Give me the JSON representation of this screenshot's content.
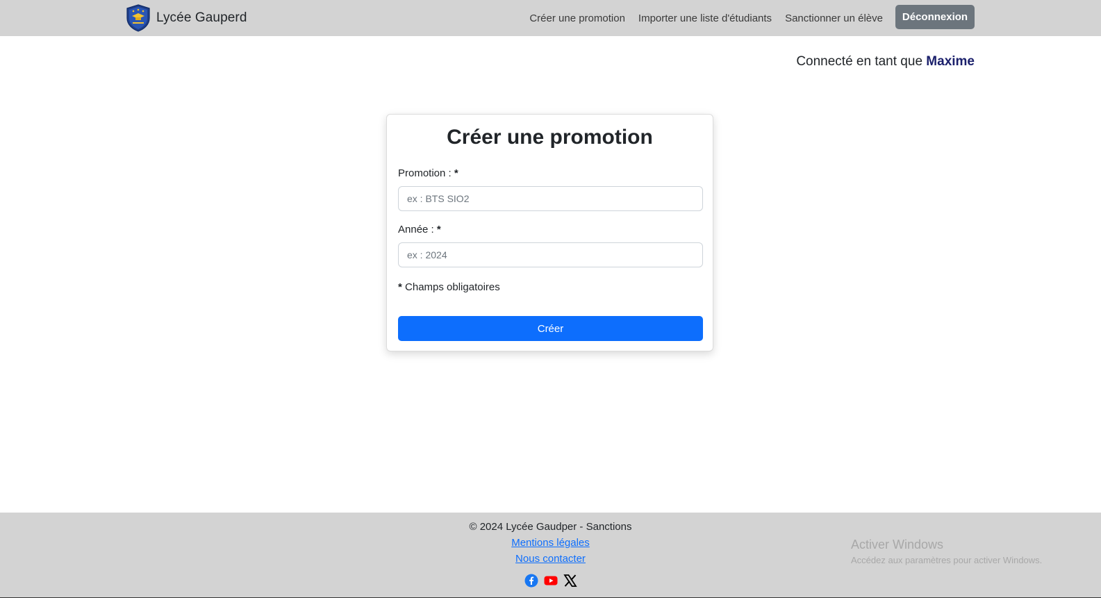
{
  "navbar": {
    "brand_name": "Lycée Gauperd",
    "links": [
      "Créer une promotion",
      "Importer une liste d'étudiants",
      "Sanctionner un élève"
    ],
    "logout_label": "Déconnexion",
    "color": "#d3d3d3"
  },
  "session": {
    "prefix": "Connecté en tant que",
    "username": "Maxime"
  },
  "form": {
    "title": "Créer une promotion",
    "promotion_label": "Promotion :",
    "promotion_placeholder": "ex : BTS SIO2",
    "annee_label": "Année :",
    "annee_placeholder": "ex : 2024",
    "required_mark": "*",
    "required_note": "Champs obligatoires",
    "submit_label": "Créer",
    "submit_color": "#0d6efd"
  },
  "footer": {
    "copyright": "© 2024 Lycée Gaudper - Sanctions",
    "legal_link": "Mentions légales",
    "contact_link": "Nous contacter",
    "socials": [
      "facebook-icon",
      "youtube-icon",
      "x-icon"
    ]
  },
  "watermark": {
    "title": "Activer Windows",
    "subtitle": "Accédez aux paramètres pour activer Windows."
  }
}
